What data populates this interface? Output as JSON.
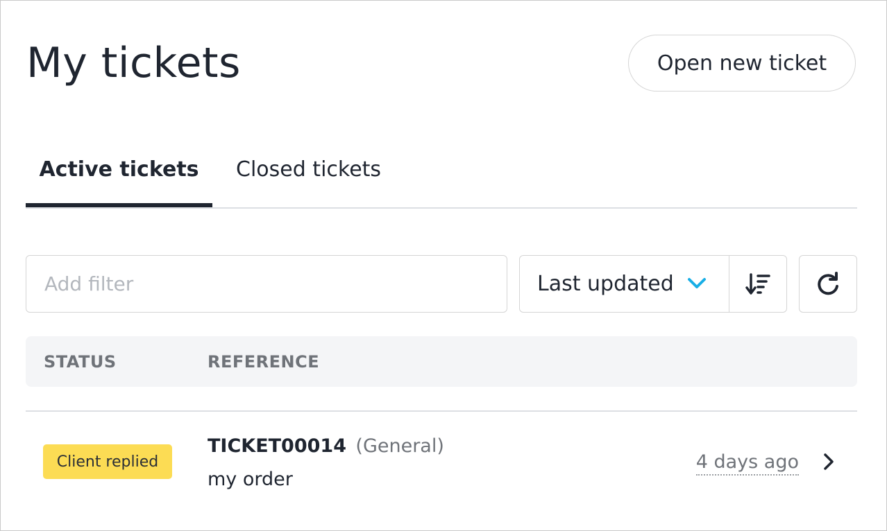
{
  "page": {
    "title": "My tickets",
    "new_ticket_label": "Open new ticket"
  },
  "tabs": [
    {
      "label": "Active tickets",
      "active": true
    },
    {
      "label": "Closed tickets",
      "active": false
    }
  ],
  "toolbar": {
    "filter_placeholder": "Add filter",
    "filter_value": "",
    "sort_selected": "Last updated",
    "sort_icon": "sort-descending-icon",
    "refresh_icon": "refresh-icon",
    "chevron_color": "#18aee6"
  },
  "table": {
    "columns": [
      "STATUS",
      "REFERENCE"
    ],
    "rows": [
      {
        "status": "Client replied",
        "status_color": "#fcdc54",
        "reference": "TICKET00014",
        "category": "(General)",
        "subject": "my order",
        "updated": "4 days ago"
      }
    ]
  }
}
